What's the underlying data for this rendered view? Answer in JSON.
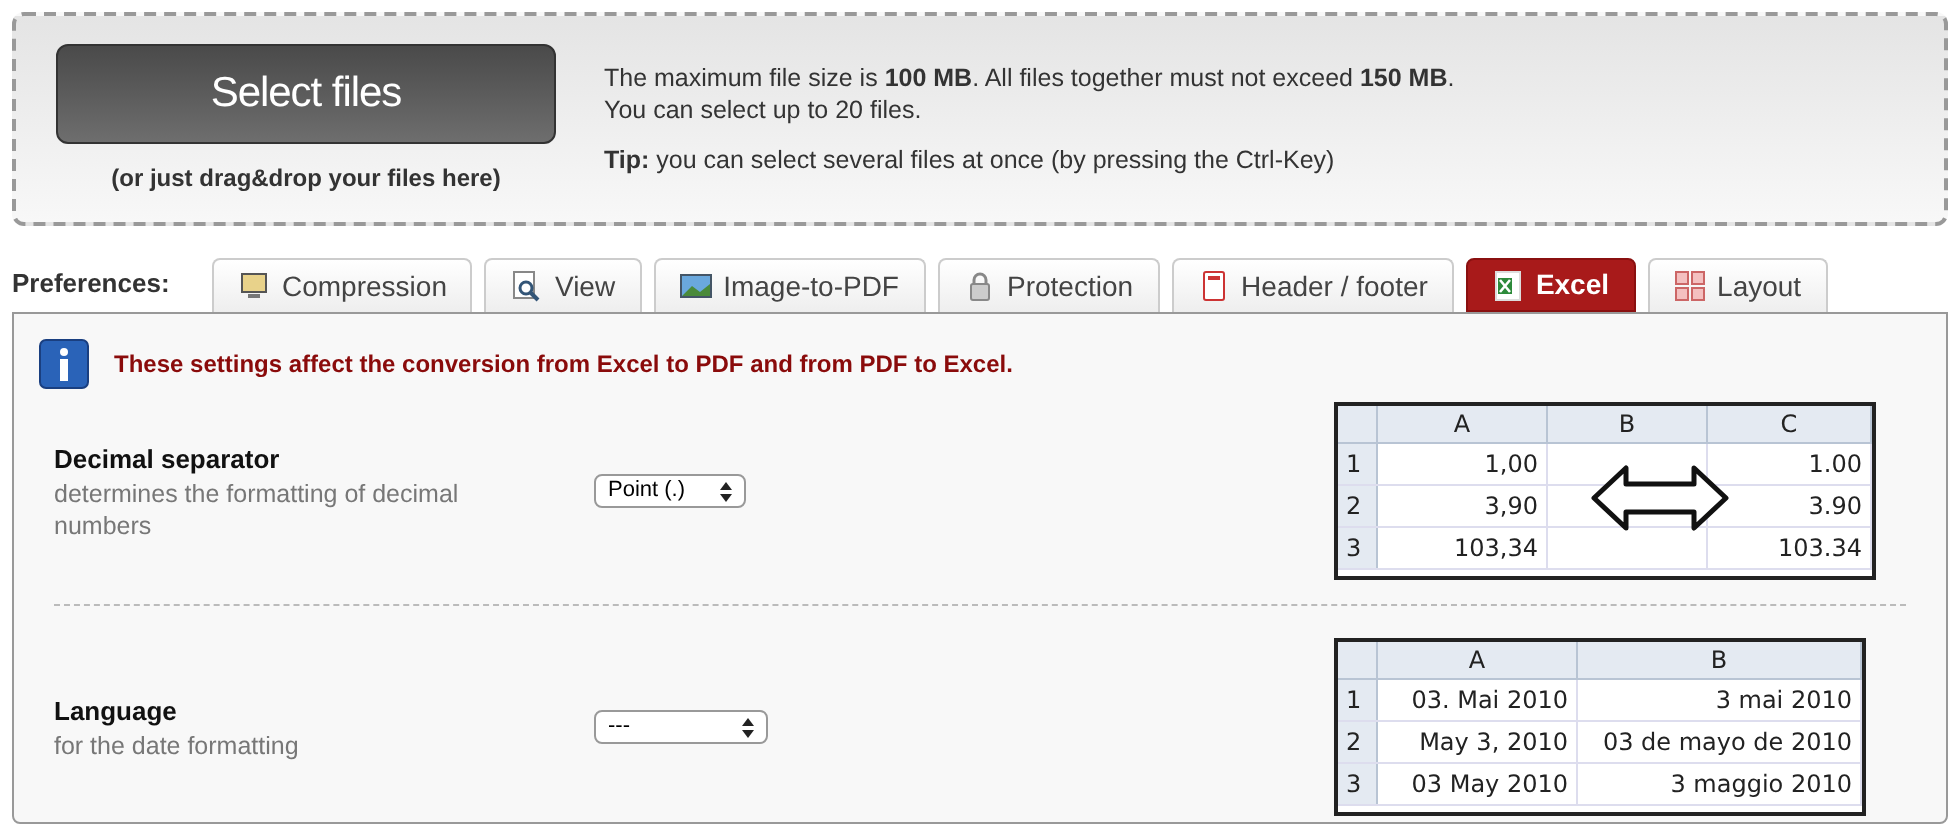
{
  "upload": {
    "button": "Select files",
    "hint": "(or just drag&drop your files here)",
    "info": [
      "The maximum file size is **100 MB**. All files together must not exceed **150 MB**.",
      "You can select up to 20 files."
    ],
    "tip": "**Tip:** you can select several files at once (by pressing the Ctrl-Key)"
  },
  "preferences_label": "Preferences:",
  "tabs": [
    {
      "label": "Compression",
      "selected": false
    },
    {
      "label": "View",
      "selected": false
    },
    {
      "label": "Image-to-PDF",
      "selected": false
    },
    {
      "label": "Protection",
      "selected": false
    },
    {
      "label": "Header / footer",
      "selected": false
    },
    {
      "label": "Excel",
      "selected": true
    },
    {
      "label": "Layout",
      "selected": false
    }
  ],
  "notice": "These settings affect the conversion from Excel to PDF and from PDF to Excel.",
  "settings": [
    {
      "title": "Decimal separator",
      "description": "determines the formatting of decimal numbers",
      "value": "Point (.)",
      "example": {
        "columns": [
          "A",
          "B",
          "C"
        ],
        "rows": [
          {
            "number": "1",
            "cells": [
              "1,00",
              "",
              "1.00"
            ]
          },
          {
            "number": "2",
            "cells": [
              "3,90",
              "",
              "3.90"
            ]
          },
          {
            "number": "3",
            "cells": [
              "103,34",
              "",
              "103.34"
            ]
          }
        ],
        "arrow": true
      }
    },
    {
      "title": "Language",
      "description": "for the date formatting",
      "value": "---",
      "example": {
        "columns": [
          "A",
          "B"
        ],
        "rows": [
          {
            "number": "1",
            "cells": [
              "03. Mai 2010",
              "3 mai 2010"
            ]
          },
          {
            "number": "2",
            "cells": [
              "May 3, 2010",
              "03 de mayo de 2010"
            ]
          },
          {
            "number": "3",
            "cells": [
              "03 May 2010",
              "3 maggio 2010"
            ]
          }
        ],
        "arrow": false
      }
    }
  ]
}
